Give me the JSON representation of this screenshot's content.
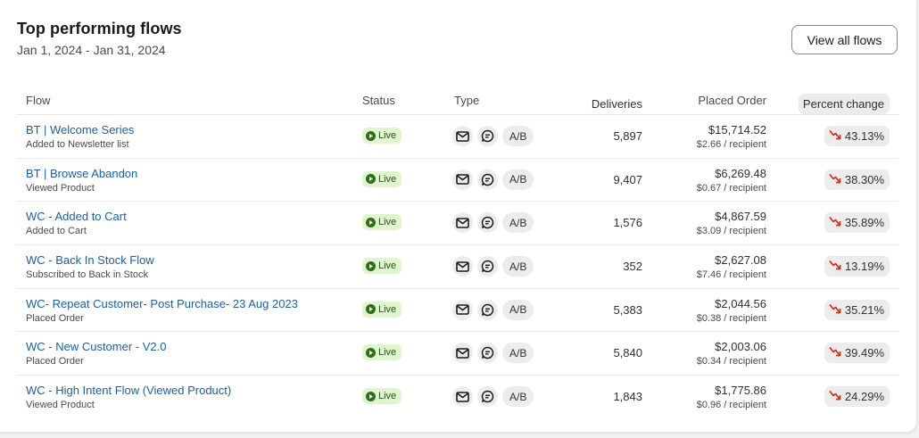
{
  "header": {
    "title": "Top performing flows",
    "date_range": "Jan 1, 2024 - Jan 31, 2024",
    "view_all_label": "View all flows"
  },
  "table": {
    "columns": {
      "flow": "Flow",
      "status": "Status",
      "type": "Type",
      "deliveries": "Deliveries",
      "placed_order": "Placed Order",
      "percent_change": "Percent change"
    },
    "rows": [
      {
        "name": "BT | Welcome Series",
        "trigger": "Added to Newsletter list",
        "status": "Live",
        "type_ab": "A/B",
        "deliveries": "5,897",
        "placed_order": "$15,714.52",
        "per_recipient": "$2.66 / recipient",
        "percent_change": "43.13%"
      },
      {
        "name": "BT | Browse Abandon",
        "trigger": "Viewed Product",
        "status": "Live",
        "type_ab": "A/B",
        "deliveries": "9,407",
        "placed_order": "$6,269.48",
        "per_recipient": "$0.67 / recipient",
        "percent_change": "38.30%"
      },
      {
        "name": "WC - Added to Cart",
        "trigger": "Added to Cart",
        "status": "Live",
        "type_ab": "A/B",
        "deliveries": "1,576",
        "placed_order": "$4,867.59",
        "per_recipient": "$3.09 / recipient",
        "percent_change": "35.89%"
      },
      {
        "name": "WC - Back In Stock Flow",
        "trigger": "Subscribed to Back in Stock",
        "status": "Live",
        "type_ab": "A/B",
        "deliveries": "352",
        "placed_order": "$2,627.08",
        "per_recipient": "$7.46 / recipient",
        "percent_change": "13.19%"
      },
      {
        "name": "WC- Repeat Customer- Post Purchase- 23 Aug 2023",
        "trigger": "Placed Order",
        "status": "Live",
        "type_ab": "A/B",
        "deliveries": "5,383",
        "placed_order": "$2,044.56",
        "per_recipient": "$0.38 / recipient",
        "percent_change": "35.21%"
      },
      {
        "name": "WC - New Customer - V2.0",
        "trigger": "Placed Order",
        "status": "Live",
        "type_ab": "A/B",
        "deliveries": "5,840",
        "placed_order": "$2,003.06",
        "per_recipient": "$0.34 / recipient",
        "percent_change": "39.49%"
      },
      {
        "name": "WC - High Intent Flow (Viewed Product)",
        "trigger": "Viewed Product",
        "status": "Live",
        "type_ab": "A/B",
        "deliveries": "1,843",
        "placed_order": "$1,775.86",
        "per_recipient": "$0.96 / recipient",
        "percent_change": "24.29%"
      }
    ]
  },
  "icons": {
    "live_status": "play-circle-icon",
    "email_type": "envelope-icon",
    "sms_type": "chat-bubble-icon",
    "trend": "trend-down-icon"
  },
  "colors": {
    "link": "#1a5fa8",
    "live_bg": "#dff5cf",
    "live_fg": "#2e6f13",
    "trend_down": "#d82c0d"
  }
}
